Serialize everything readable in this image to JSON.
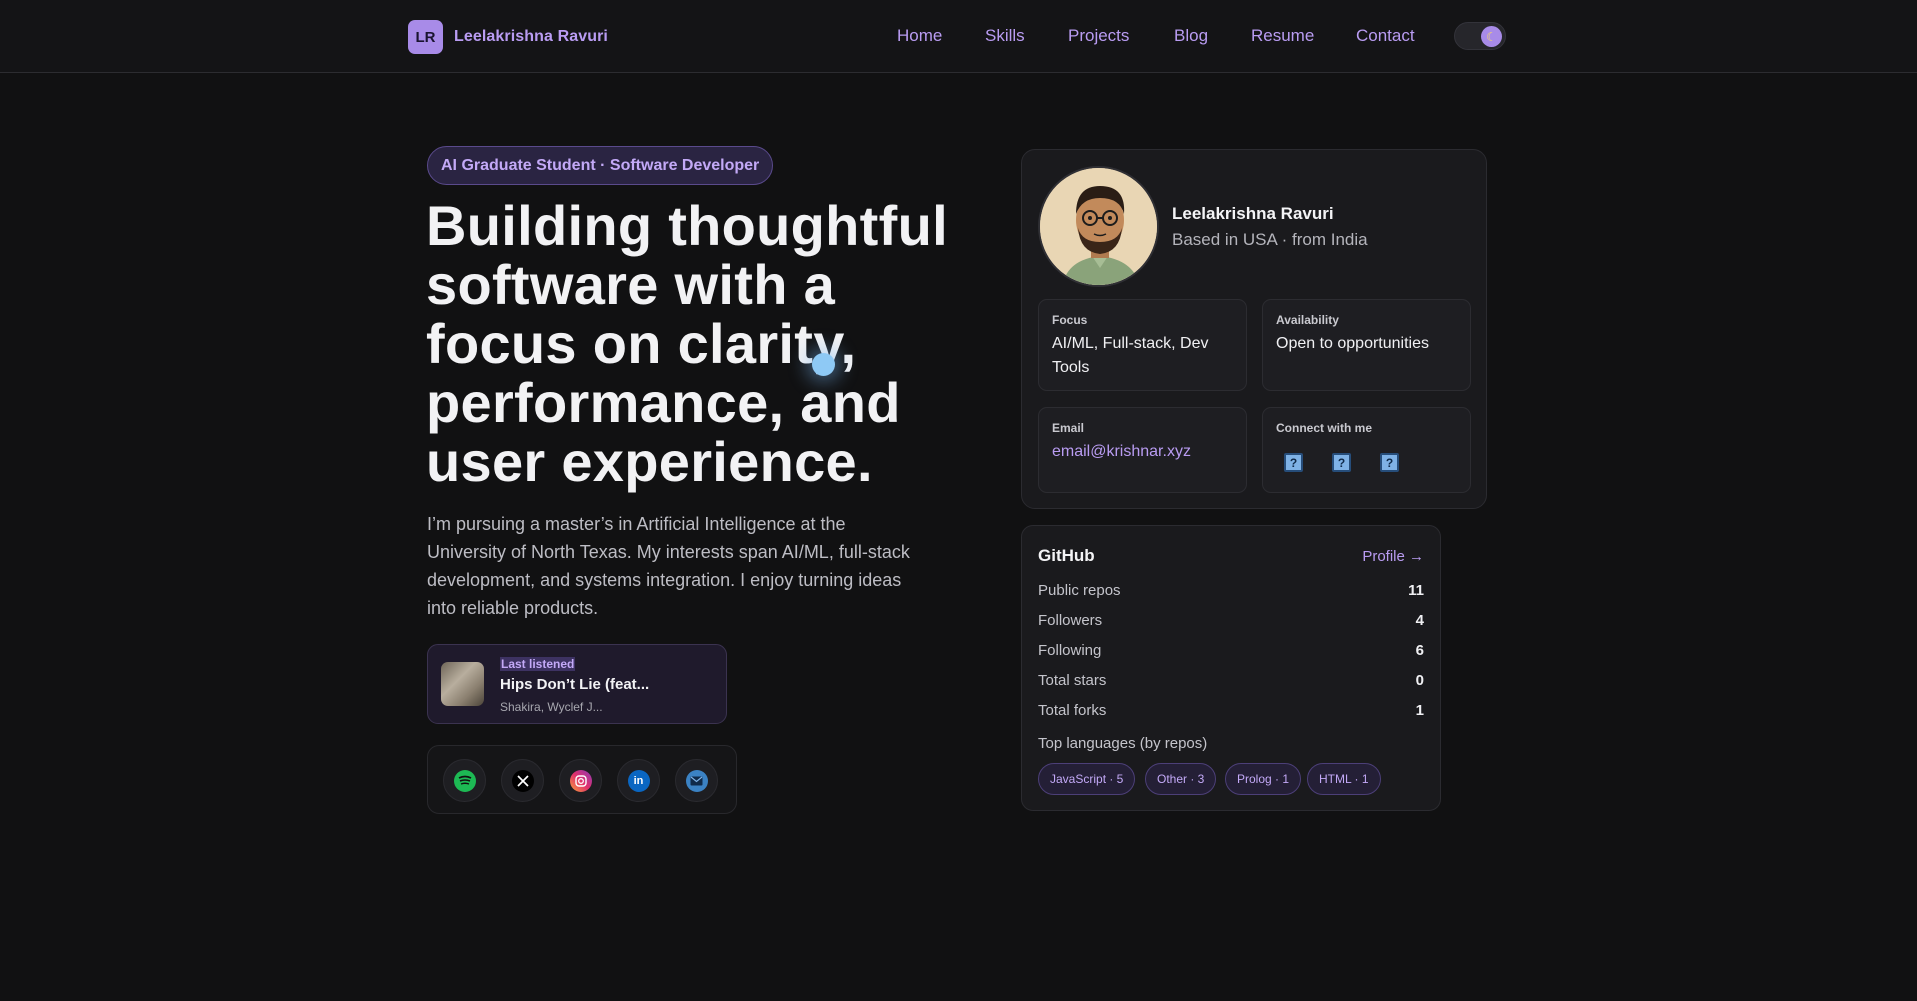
{
  "navbar": {
    "logo_initials": "LR",
    "brand_name": "Leelakrishna Ravuri",
    "links": [
      "Home",
      "Skills",
      "Projects",
      "Blog",
      "Resume",
      "Contact"
    ],
    "theme_toggle_icon": "moon-icon"
  },
  "hero": {
    "badge": "AI Graduate Student · Software Developer",
    "headline": "Building thoughtful software with a focus on clarity, performance, and user experience.",
    "bio": "I’m pursuing a master’s in Artificial Intelligence at the University of North Texas. My interests span AI/ML, full-stack development, and systems integration. I enjoy turning ideas into reliable products.",
    "music": {
      "label": "Last listened",
      "title": "Hips Don’t Lie (feat...",
      "artist": "Shakira, Wyclef J..."
    },
    "socials": [
      {
        "name": "spotify-icon",
        "color": "#1db954"
      },
      {
        "name": "x-icon",
        "color": "#000000"
      },
      {
        "name": "instagram-icon",
        "color": "#e1306c"
      },
      {
        "name": "linkedin-icon",
        "color": "#0a66c2"
      },
      {
        "name": "email-icon",
        "color": "#3b82c4"
      }
    ]
  },
  "profile": {
    "name": "Leelakrishna Ravuri",
    "location": "Based in USA · from India",
    "focus_label": "Focus",
    "focus_value": "AI/ML, Full-stack, Dev Tools",
    "availability_label": "Availability",
    "availability_value": "Open to opportunities",
    "email_label": "Email",
    "email_value": "email@krishnar.xyz",
    "connect_label": "Connect with me",
    "connect_icon_glyph": "?"
  },
  "github": {
    "title": "GitHub",
    "profile_link": "Profile →",
    "stats": [
      {
        "label": "Public repos",
        "value": "11"
      },
      {
        "label": "Followers",
        "value": "4"
      },
      {
        "label": "Following",
        "value": "6"
      },
      {
        "label": "Total stars",
        "value": "0"
      },
      {
        "label": "Total forks",
        "value": "1"
      }
    ],
    "languages_title": "Top languages (by repos)",
    "languages": [
      "JavaScript · 5",
      "Other · 3",
      "Prolog · 1",
      "HTML · 1"
    ]
  },
  "colors": {
    "accent": "#b99cf2",
    "background": "#111112",
    "card": "#1a1a1d"
  }
}
